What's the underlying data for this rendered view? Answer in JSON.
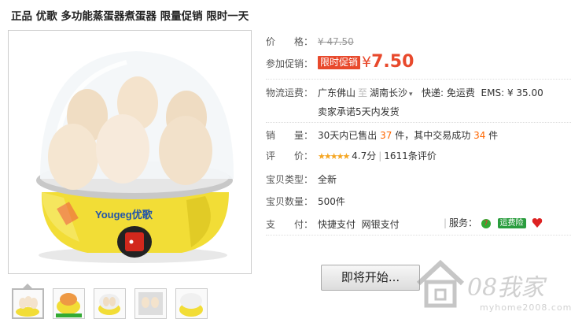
{
  "title": "正品 优歌 多功能蒸蛋器煮蛋器 限量促销 限时一天",
  "brand_label": "Yougeg优歌",
  "price": {
    "label": "价　　格：",
    "original": "¥ 47.50"
  },
  "promo": {
    "label": "参加促销：",
    "tag": "限时促销",
    "currency": "¥",
    "amount": "7.50"
  },
  "shipping": {
    "label": "物流运费：",
    "from": "广东佛山",
    "to_sep": "至",
    "to": "湖南长沙",
    "express": "快递: 免运费",
    "ems": "EMS: ¥ 35.00",
    "note": "卖家承诺5天内发货"
  },
  "sales": {
    "label": "销　　量：",
    "prefix": "30天内已售出",
    "sold": "37",
    "middle": "件，其中交易成功",
    "success": "34",
    "suffix": "件"
  },
  "rating": {
    "label": "评　　价：",
    "stars": "★★★★★",
    "score": "4.7分",
    "reviews": "1611条评价"
  },
  "type": {
    "label": "宝贝类型：",
    "value": "全新"
  },
  "quantity": {
    "label": "宝贝数量：",
    "value": "500件"
  },
  "payment": {
    "label": "支　　付：",
    "method1": "快捷支付",
    "method2": "网银支付",
    "service_label": "服务：",
    "service_num": "7",
    "insurance": "运费险"
  },
  "buy_button": "即将开始...",
  "watermark": {
    "text": "08我家",
    "url": "myhome2008.com"
  },
  "colors": {
    "accent": "#e8492c",
    "orange": "#ff6600"
  }
}
